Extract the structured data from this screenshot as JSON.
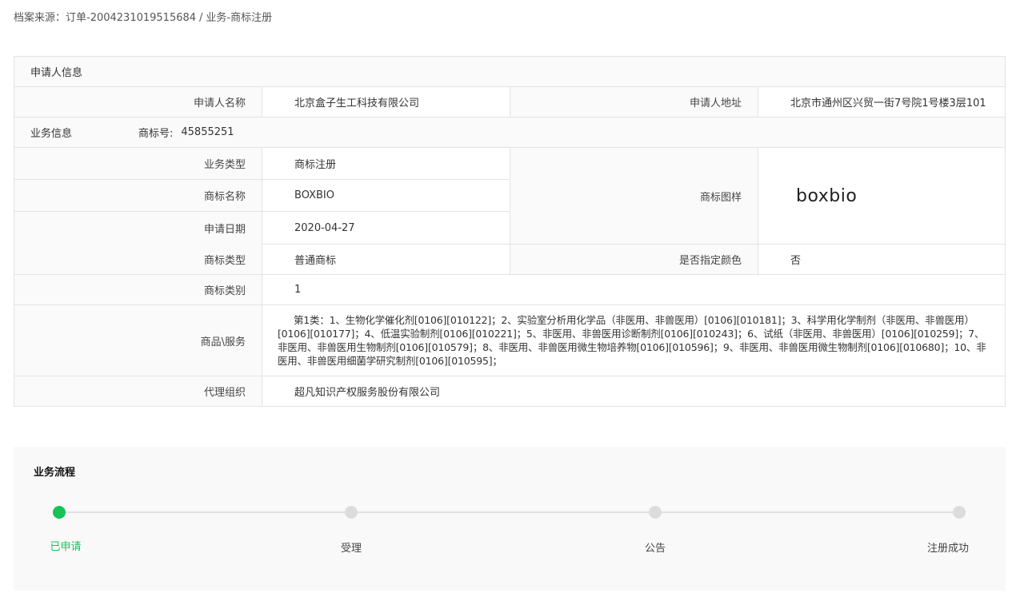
{
  "breadcrumb": {
    "prefix": "档案来源：订单-2004231019515684",
    "separator": "/",
    "suffix": "业务-商标注册"
  },
  "applicant": {
    "section_title": "申请人信息",
    "name_label": "申请人名称",
    "name_value": "北京盒子生工科技有限公司",
    "address_label": "申请人地址",
    "address_value": "北京市通州区兴贸一街7号院1号楼3层101"
  },
  "business": {
    "section_title": "业务信息",
    "tm_no_label": "商标号:",
    "tm_no_value": "45855251",
    "type_label": "业务类型",
    "type_value": "商标注册",
    "tm_name_label": "商标名称",
    "tm_name_value": "BOXBIO",
    "apply_date_label": "申请日期",
    "apply_date_value": "2020-04-27",
    "tm_image_label": "商标图样",
    "tm_image_logo": "boxbio",
    "tm_kind_label": "商标类型",
    "tm_kind_value": "普通商标",
    "color_label": "是否指定颜色",
    "color_value": "否",
    "category_label": "商标类别",
    "category_value": "1",
    "goods_label": "商品\\服务",
    "goods_value": "第1类：1、生物化学催化剂[0106][010122]；2、实验室分析用化学品（非医用、非兽医用）[0106][010181]；3、科学用化学制剂（非医用、非兽医用）[0106][010177]；4、低温实验制剂[0106][010221]；5、非医用、非兽医用诊断制剂[0106][010243]；6、试纸（非医用、非兽医用）[0106][010259]；7、非医用、非兽医用生物制剂[0106][010579]；8、非医用、非兽医用微生物培养物[0106][010596]；9、非医用、非兽医用微生物制剂[0106][010680]；10、非医用、非兽医用细菌学研究制剂[0106][010595]；",
    "agent_label": "代理组织",
    "agent_value": "超凡知识产权服务股份有限公司"
  },
  "process": {
    "title": "业务流程",
    "steps": [
      {
        "label": "已申请",
        "active": true
      },
      {
        "label": "受理",
        "active": false
      },
      {
        "label": "公告",
        "active": false
      },
      {
        "label": "注册成功",
        "active": false
      }
    ],
    "active_color": "#19c15a",
    "inactive_color": "#dcdcdc"
  }
}
